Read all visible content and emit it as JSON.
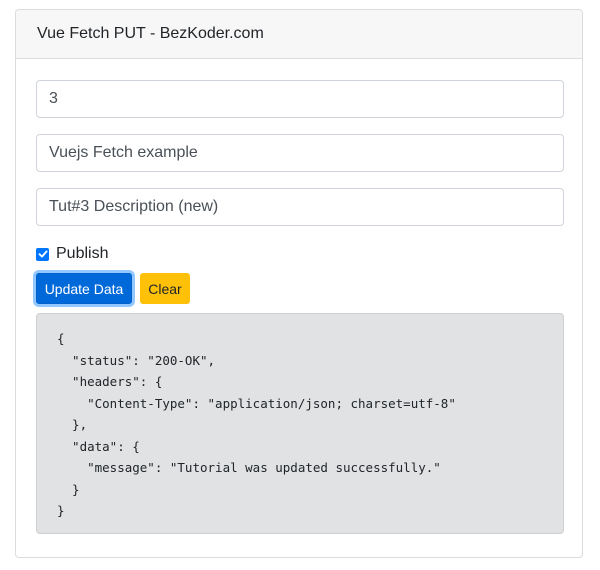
{
  "card": {
    "title": "Vue Fetch PUT - BezKoder.com"
  },
  "form": {
    "id_value": "3",
    "title_value": "Vuejs Fetch example",
    "description_value": "Tut#3 Description (new)",
    "publish_label": "Publish",
    "publish_checked": true
  },
  "buttons": {
    "update_label": "Update Data",
    "clear_label": "Clear"
  },
  "result": {
    "text": "{\n  \"status\": \"200-OK\",\n  \"headers\": {\n    \"Content-Type\": \"application/json; charset=utf-8\"\n  },\n  \"data\": {\n    \"message\": \"Tutorial was updated successfully.\"\n  }\n}"
  },
  "colors": {
    "primary": "#0069d9",
    "warning": "#ffc107",
    "checkbox": "#0075ff"
  },
  "icons": {
    "checkbox": "checkmark-icon"
  }
}
